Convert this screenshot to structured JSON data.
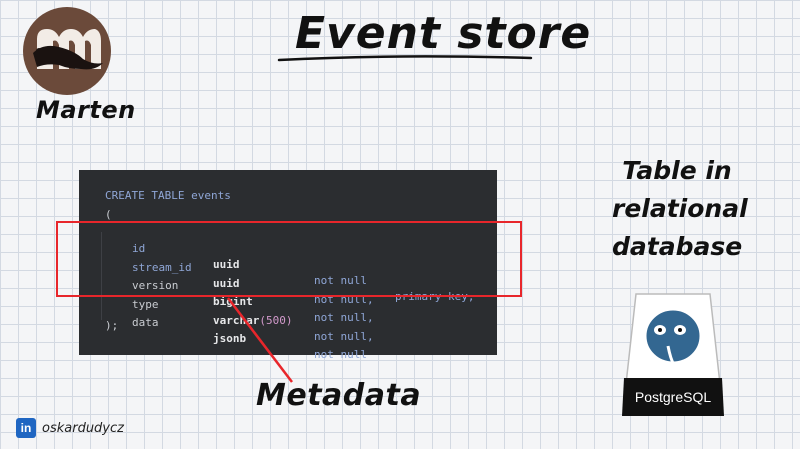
{
  "header": {
    "title": "Event store"
  },
  "brand": {
    "name": "Marten",
    "logo_icon": "marten-logo-icon"
  },
  "code": {
    "create_line": {
      "keyword": "CREATE TABLE",
      "table_name": "events"
    },
    "open_paren": "(",
    "rows": [
      {
        "name": "id",
        "type": "uuid",
        "type_arg": "",
        "constraint": "not null",
        "extra": "primary key,"
      },
      {
        "name": "stream_id",
        "type": "uuid",
        "type_arg": "",
        "constraint": "not null,",
        "extra": ""
      },
      {
        "name": "version",
        "type": "bigint",
        "type_arg": "",
        "constraint": "not null,",
        "extra": ""
      },
      {
        "name": "type",
        "type": "varchar",
        "type_arg": "(500)",
        "constraint": "not null,",
        "extra": ""
      },
      {
        "name": "data",
        "type": "jsonb",
        "type_arg": "",
        "constraint": "not null",
        "extra": ""
      }
    ],
    "close_paren": ");"
  },
  "side_note": {
    "line1": "Table in",
    "line2": "relational",
    "line3": "database"
  },
  "postgres": {
    "label": "PostgreSQL",
    "icon": "postgresql-elephant-icon"
  },
  "annotation": {
    "label": "Metadata",
    "color": "#e8262b"
  },
  "footer": {
    "linkedin_icon_text": "in",
    "handle": "oskardudycz"
  },
  "colors": {
    "code_bg": "#2b2d30",
    "keyword": "#8fa6d6",
    "highlight": "#e8262b",
    "linkedin": "#1f66c2"
  }
}
